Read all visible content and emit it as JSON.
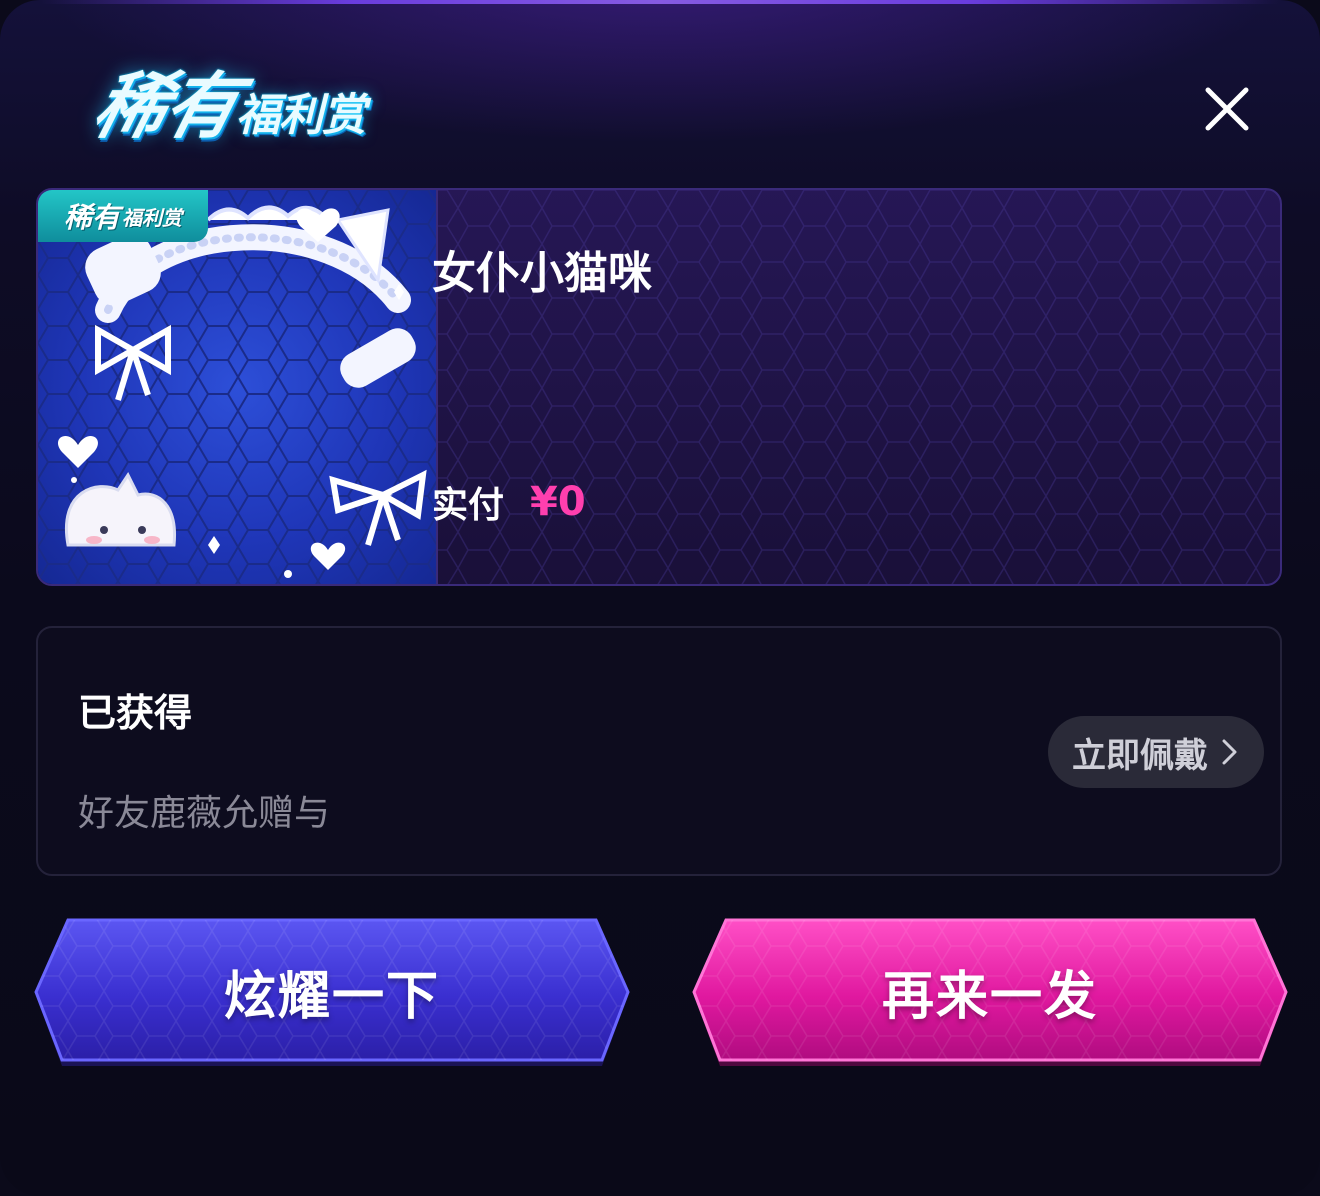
{
  "header": {
    "title_main": "稀有",
    "title_sub": "福利赏",
    "close_icon": "close-icon"
  },
  "item": {
    "badge_main": "稀有",
    "badge_sub": "福利赏",
    "name": "女仆小猫咪",
    "price_label": "实付",
    "price_value": "¥0",
    "thumbnail_icon": "maid-cat-avatar-frame"
  },
  "obtained": {
    "title": "已获得",
    "description": "好友鹿薇允赠与",
    "wear_button": "立即佩戴",
    "wear_icon": "chevron-right-icon"
  },
  "actions": {
    "show_off": "炫耀一下",
    "draw_again": "再来一发"
  },
  "colors": {
    "accent_pink": "#ff3fae",
    "button_blue": "#3d33d6",
    "button_pink": "#e01aa0",
    "background": "#0b0a1a",
    "badge_teal": "#1aa9b5"
  }
}
